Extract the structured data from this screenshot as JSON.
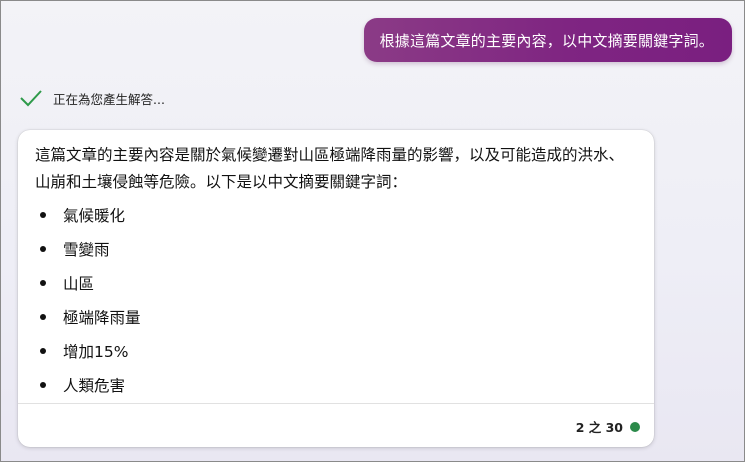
{
  "user_message": {
    "text": "根據這篇文章的主要內容，以中文摘要關鍵字詞。"
  },
  "status": {
    "icon": "check-icon",
    "text": "正在為您產生解答..."
  },
  "response": {
    "paragraph": "這篇文章的主要內容是關於氣候變遷對山區極端降雨量的影響，以及可能造成的洪水、山崩和土壤侵蝕等危險。以下是以中文摘要關鍵字詞：",
    "keywords": [
      "氣候暖化",
      "雪變雨",
      "山區",
      "極端降雨量",
      "增加15%",
      "人類危害"
    ],
    "counter": "2 之 30",
    "status_color": "#2b8a4a"
  }
}
